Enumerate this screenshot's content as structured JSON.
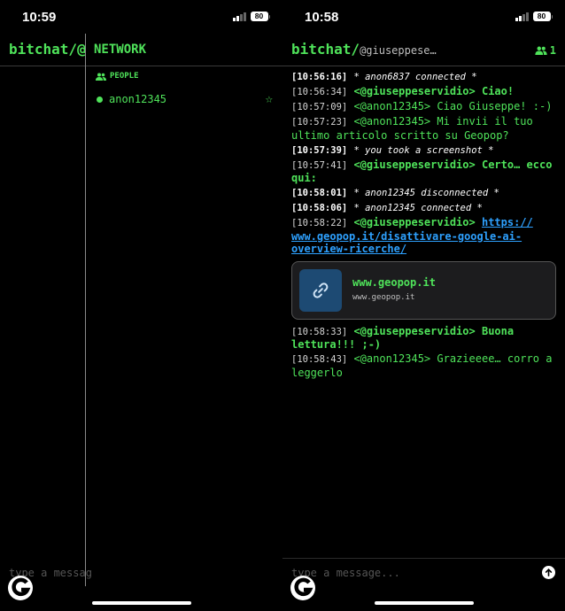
{
  "left": {
    "status": {
      "time": "10:59",
      "battery": "80"
    },
    "header_title": "bitchat/@g",
    "drawer": {
      "title": "NETWORK",
      "section_label": "PEOPLE",
      "peers": [
        {
          "name": "anon12345",
          "favorite_icon": "star-outline-icon"
        }
      ]
    },
    "input_placeholder": "type a messag"
  },
  "right": {
    "status": {
      "time": "10:58",
      "battery": "80"
    },
    "header": {
      "app": "bitchat/",
      "nickname": "@giuseppese…",
      "people_count": "1"
    },
    "messages": [
      {
        "ts": "[10:56:16]",
        "kind": "system",
        "text": "* anon6837 connected *"
      },
      {
        "ts": "[10:56:34]",
        "kind": "me",
        "sender": "<@giuseppeservidio>",
        "text": "Ciao!"
      },
      {
        "ts": "[10:57:09]",
        "kind": "other",
        "sender": "<@anon12345>",
        "text": "Ciao Giuseppe! :-)"
      },
      {
        "ts": "[10:57:23]",
        "kind": "other",
        "sender": "<@anon12345>",
        "text": "Mi invii il tuo ultimo articolo scritto su Geopop?"
      },
      {
        "ts": "[10:57:39]",
        "kind": "system",
        "text": "* you took a screenshot *"
      },
      {
        "ts": "[10:57:41]",
        "kind": "me",
        "sender": "<@giuseppeservidio>",
        "text": "Certo… ecco qui:"
      },
      {
        "ts": "[10:58:01]",
        "kind": "system",
        "text": "* anon12345 disconnected *"
      },
      {
        "ts": "[10:58:06]",
        "kind": "system",
        "text": "* anon12345 connected *"
      },
      {
        "ts": "[10:58:22]",
        "kind": "me",
        "sender": "<@giuseppeservidio>",
        "text": "https:// www.geopop.it/disattivare-google-ai-overview-ricerche/",
        "is_link": true
      }
    ],
    "link_preview": {
      "title": "www.geopop.it",
      "subtitle": "www.geopop.it",
      "icon": "link-icon"
    },
    "messages_after": [
      {
        "ts": "[10:58:33]",
        "kind": "me",
        "sender": "<@giuseppeservidio>",
        "text": "Buona lettura!!! ;-)"
      },
      {
        "ts": "[10:58:43]",
        "kind": "other",
        "sender": "<@anon12345>",
        "text": "Grazieeee… corro a leggerlo"
      }
    ],
    "input_placeholder": "type a message..."
  },
  "colors": {
    "accent": "#4fe35a",
    "link": "#2ea1ff",
    "background": "#000000"
  }
}
